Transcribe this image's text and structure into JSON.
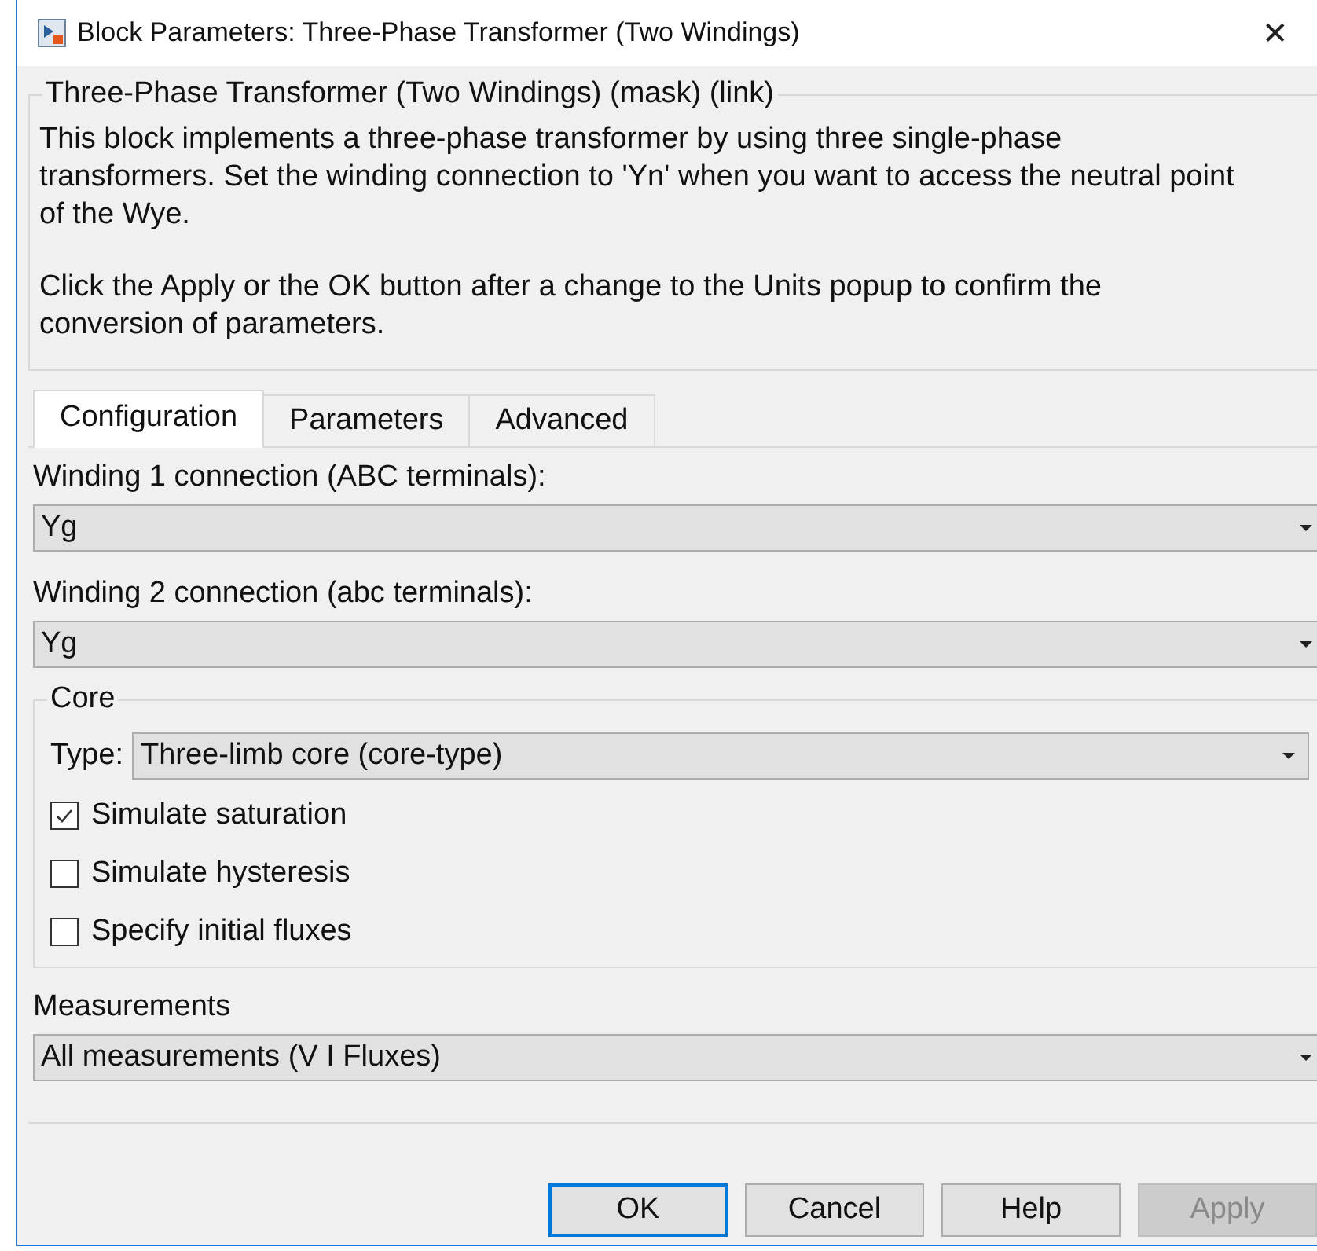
{
  "window": {
    "title": "Block Parameters: Three-Phase Transformer (Two Windings)",
    "close": "✕"
  },
  "description": {
    "title": "Three-Phase Transformer (Two Windings) (mask) (link)",
    "paragraphs": [
      "This block implements a three-phase transformer by using three single-phase transformers. Set the winding connection to 'Yn'  when you want to access the neutral point of the Wye.",
      "Click the Apply or the OK button after a change to the Units popup to confirm the conversion of parameters."
    ]
  },
  "tabs": [
    {
      "label": "Configuration",
      "selected": true
    },
    {
      "label": "Parameters",
      "selected": false
    },
    {
      "label": "Advanced",
      "selected": false
    }
  ],
  "fields": [
    {
      "label": "Winding 1 connection (ABC terminals):",
      "value": "Yg"
    },
    {
      "label": "Winding 2 connection (abc terminals):",
      "value": "Yg"
    }
  ],
  "core": {
    "title": "Core",
    "type_label": "Type:",
    "type_value": "Three-limb core (core-type)",
    "checkboxes": [
      {
        "label": "Simulate saturation",
        "checked": true
      },
      {
        "label": "Simulate hysteresis",
        "checked": false
      },
      {
        "label": "Specify initial fluxes",
        "checked": false
      }
    ]
  },
  "measurements": {
    "label": "Measurements",
    "value": "All measurements (V I Fluxes)"
  },
  "buttons": [
    {
      "label": "OK",
      "default": true,
      "disabled": false
    },
    {
      "label": "Cancel",
      "default": false,
      "disabled": false
    },
    {
      "label": "Help",
      "default": false,
      "disabled": false
    },
    {
      "label": "Apply",
      "default": false,
      "disabled": true
    }
  ]
}
